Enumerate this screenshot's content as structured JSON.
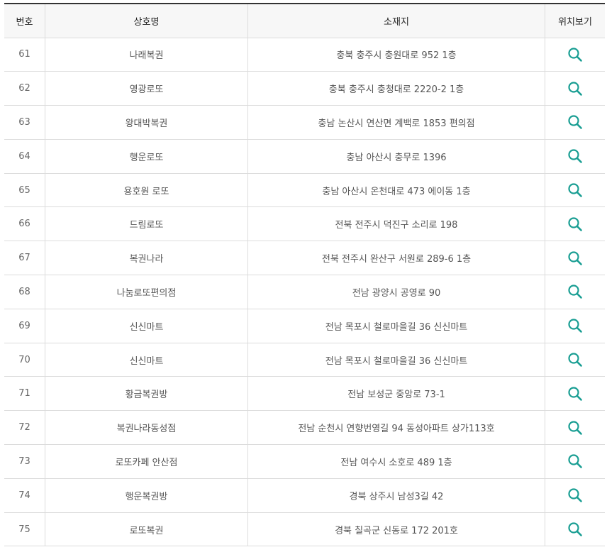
{
  "table": {
    "headers": {
      "no": "번호",
      "name": "상호명",
      "address": "소재지",
      "map": "위치보기"
    },
    "icon_color": "#1a9e93",
    "map_icon": "search-icon",
    "rows": [
      {
        "no": "61",
        "name": "나래복권",
        "address": "충북 충주시 충원대로 952 1층"
      },
      {
        "no": "62",
        "name": "영광로또",
        "address": "충북 충주시 충청대로 2220-2 1층"
      },
      {
        "no": "63",
        "name": "왕대박복권",
        "address": "충남 논산시 연산면 계백로 1853 편의점"
      },
      {
        "no": "64",
        "name": "행운로또",
        "address": "충남 아산시 충무로 1396"
      },
      {
        "no": "65",
        "name": "용호원 로또",
        "address": "충남 아산시 온천대로 473 에이동 1층"
      },
      {
        "no": "66",
        "name": "드림로또",
        "address": "전북 전주시 덕진구 소리로 198"
      },
      {
        "no": "67",
        "name": "복권나라",
        "address": "전북 전주시 완산구 서원로 289-6 1층"
      },
      {
        "no": "68",
        "name": "나눔로또편의점",
        "address": "전남 광양시 공영로 90"
      },
      {
        "no": "69",
        "name": "신신마트",
        "address": "전남 목포시 철로마을길 36 신신마트"
      },
      {
        "no": "70",
        "name": "신신마트",
        "address": "전남 목포시 철로마을길 36 신신마트"
      },
      {
        "no": "71",
        "name": "황금복권방",
        "address": "전남 보성군 중앙로 73-1"
      },
      {
        "no": "72",
        "name": "복권나라동성점",
        "address": "전남 순천시 연향번영길 94 동성아파트 상가113호"
      },
      {
        "no": "73",
        "name": "로또카페 안산점",
        "address": "전남 여수시 소호로 489 1층"
      },
      {
        "no": "74",
        "name": "행운복권방",
        "address": "경북 상주시 남성3길 42"
      },
      {
        "no": "75",
        "name": "로또복권",
        "address": "경북 칠곡군 신동로 172 201호"
      }
    ]
  }
}
